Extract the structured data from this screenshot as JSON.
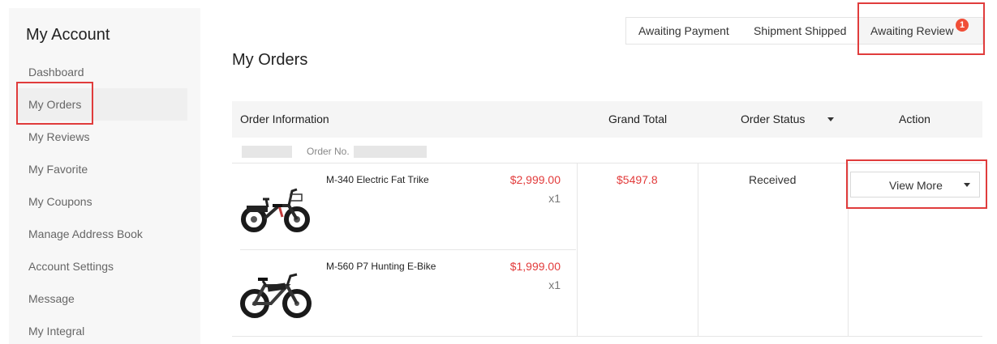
{
  "sidebar": {
    "title": "My Account",
    "items": [
      {
        "label": "Dashboard"
      },
      {
        "label": "My Orders"
      },
      {
        "label": "My Reviews"
      },
      {
        "label": "My Favorite"
      },
      {
        "label": "My Coupons"
      },
      {
        "label": "Manage Address Book"
      },
      {
        "label": "Account Settings"
      },
      {
        "label": "Message"
      },
      {
        "label": "My Integral"
      }
    ],
    "active_item": "My Orders"
  },
  "tabs": [
    {
      "label": "Awaiting Payment"
    },
    {
      "label": "Shipment Shipped"
    },
    {
      "label": "Awaiting Review",
      "badge": "1"
    }
  ],
  "main": {
    "title": "My Orders",
    "table": {
      "headers": {
        "info": "Order Information",
        "total": "Grand Total",
        "status": "Order Status",
        "action": "Action"
      }
    },
    "order": {
      "order_no_label": "Order No.",
      "items": [
        {
          "name": "M-340 Electric Fat Trike",
          "price": "$2,999.00",
          "qty": "x1"
        },
        {
          "name": "M-560 P7 Hunting E-Bike",
          "price": "$1,999.00",
          "qty": "x1"
        }
      ],
      "grand_total": "$5497.8",
      "status": "Received",
      "action_label": "View More"
    }
  },
  "colors": {
    "price_red": "#e23b3b",
    "badge_red": "#f04e37",
    "highlight_red": "#e03c3c"
  }
}
